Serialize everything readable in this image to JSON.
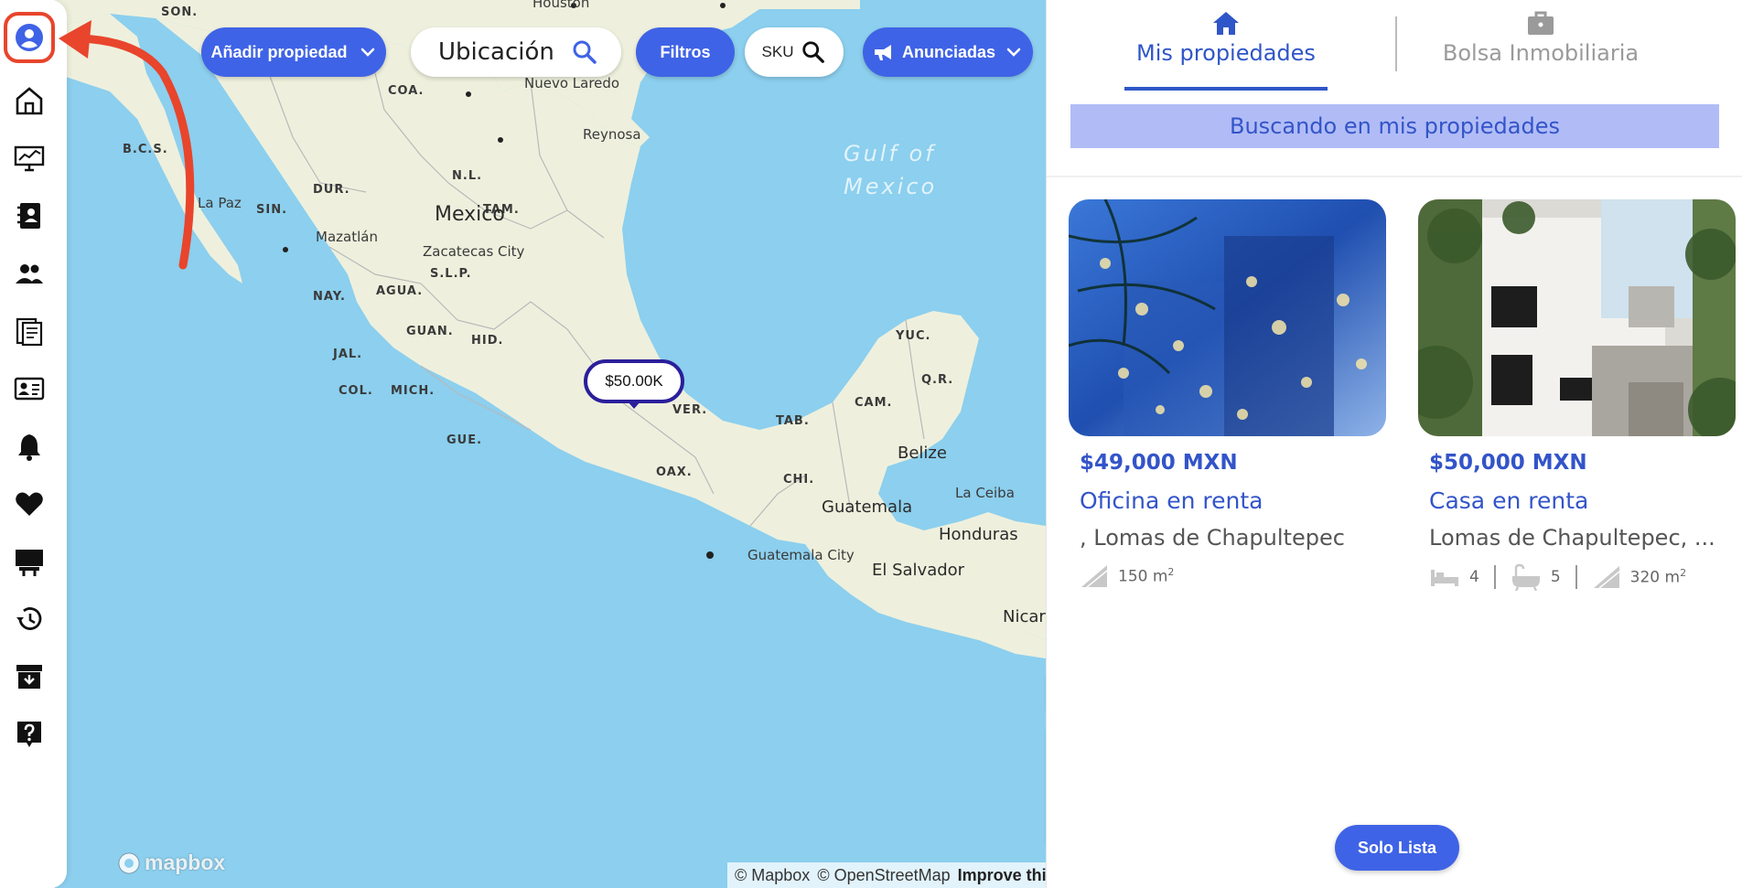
{
  "sidebar": {
    "items": [
      {
        "icon": "user-profile-icon"
      },
      {
        "icon": "home-icon"
      },
      {
        "icon": "analytics-monitor-icon"
      },
      {
        "icon": "contacts-book-icon"
      },
      {
        "icon": "users-icon"
      },
      {
        "icon": "documents-icon"
      },
      {
        "icon": "id-card-icon"
      },
      {
        "icon": "bell-icon"
      },
      {
        "icon": "heart-icon"
      },
      {
        "icon": "billboard-icon"
      },
      {
        "icon": "history-icon"
      },
      {
        "icon": "archive-icon"
      },
      {
        "icon": "help-icon"
      }
    ],
    "accent": "#e8452c"
  },
  "toolbar": {
    "add_property": "Añadir propiedad",
    "location": "Ubicación",
    "filters": "Filtros",
    "sku": "SKU",
    "listed": "Anunciadas"
  },
  "map": {
    "states": [
      "SON.",
      "COA.",
      "B.C.S.",
      "DUR.",
      "N.L.",
      "SIN.",
      "TAM.",
      "S.L.P.",
      "NAY.",
      "AGUA.",
      "GUAN.",
      "HID.",
      "JAL.",
      "COL.",
      "MICH.",
      "VER.",
      "GUE.",
      "OAX.",
      "TAB.",
      "CAM.",
      "YUC.",
      "Q.R.",
      "CHI."
    ],
    "cities": [
      "Houston",
      "Nuevo Laredo",
      "Reynosa",
      "La Paz",
      "Mazatlán",
      "Zacatecas City",
      "Guatemala City",
      "La Ceiba"
    ],
    "countries": [
      "Mexico",
      "Belize",
      "Guatemala",
      "Honduras",
      "El Salvador",
      "Nicar"
    ],
    "sea_line1": "Gulf of",
    "sea_line2": "Mexico",
    "marker_price": "$50.00K",
    "zoom_in": "+",
    "zoom_out": "−",
    "compass": "▲",
    "logo": "mapbox",
    "attribution_1": "© Mapbox",
    "attribution_2": "© OpenStreetMap",
    "improve": "Improve this map",
    "colors": {
      "water": "#8ccfee",
      "land": "#eef0dd",
      "marker": "#2b1f9b"
    }
  },
  "panel": {
    "tab_mine": "Mis propiedades",
    "tab_bolsa": "Bolsa Inmobiliaria",
    "search_banner": "Buscando en mis propiedades",
    "solo_lista": "Solo Lista",
    "accent": "#3354c9"
  },
  "cards": [
    {
      "price": "$49,000 MXN",
      "title": "Oficina en renta",
      "address": ", Lomas de Chapultepec",
      "area": "150 m",
      "area_sup": "2"
    },
    {
      "price": "$50,000 MXN",
      "title": "Casa en renta",
      "address": "Lomas de Chapultepec, ...",
      "beds": "4",
      "baths": "5",
      "area": "320 m",
      "area_sup": "2"
    }
  ]
}
